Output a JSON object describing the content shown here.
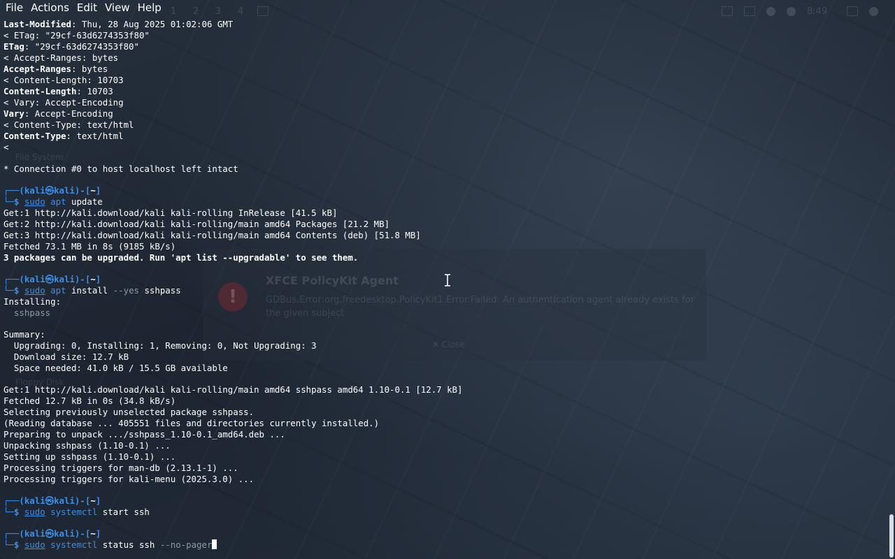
{
  "menu": [
    "File",
    "Actions",
    "Edit",
    "View",
    "Help"
  ],
  "panel": {
    "workspaces": [
      "1",
      "2",
      "3",
      "4"
    ],
    "clock": "8:49"
  },
  "ghost_dialog": {
    "title": "XFCE PolicyKit Agent",
    "message": "GDBus.Error:org.freedesktop.PolicyKit1.Error.Failed: An authentication agent already exists for the given subject",
    "button": "Close"
  },
  "ghost_desktop": {
    "icon1": "File System",
    "icon2": "Floppy Disk"
  },
  "prompt": {
    "user": "kali",
    "host": "kali",
    "dir": "~"
  },
  "terminal": {
    "header_lines": [
      {
        "key": "Last-Modified",
        "val": ": Thu, 28 Aug 2025 01:02:06 GMT",
        "bold": true
      },
      {
        "text": "< ETag: \"29cf-63d6274353f80\""
      },
      {
        "key": "ETag",
        "val": ": \"29cf-63d6274353f80\"",
        "bold": true
      },
      {
        "text": "< Accept-Ranges: bytes"
      },
      {
        "key": "Accept-Ranges",
        "val": ": bytes",
        "bold": true
      },
      {
        "text": "< Content-Length: 10703"
      },
      {
        "key": "Content-Length",
        "val": ": 10703",
        "bold": true
      },
      {
        "text": "< Vary: Accept-Encoding"
      },
      {
        "key": "Vary",
        "val": ": Accept-Encoding",
        "bold": true
      },
      {
        "text": "< Content-Type: text/html"
      },
      {
        "key": "Content-Type",
        "val": ": text/html",
        "bold": true
      },
      {
        "text": "<"
      }
    ],
    "conn_line": "* Connection #0 to host localhost left intact",
    "cmd1": {
      "sudo": "sudo",
      "prog": "apt",
      "rest": " update"
    },
    "update_output": [
      "Get:1 http://kali.download/kali kali-rolling InRelease [41.5 kB]",
      "Get:2 http://kali.download/kali kali-rolling/main amd64 Packages [21.2 MB]",
      "Get:3 http://kali.download/kali kali-rolling/main amd64 Contents (deb) [51.8 MB]",
      "Fetched 73.1 MB in 8s (9185 kB/s)"
    ],
    "upgrade_notice": "3 packages can be upgraded. Run 'apt list --upgradable' to see them.",
    "cmd2": {
      "sudo": "sudo",
      "prog": "apt",
      "mid": " install ",
      "opt": "--yes",
      "rest": " sshpass"
    },
    "installing": "Installing:",
    "pkg": "  sshpass",
    "summary_title": "Summary:",
    "summary": [
      "  Upgrading: 0, Installing: 1, Removing: 0, Not Upgrading: 3",
      "  Download size: 12.7 kB",
      "  Space needed: 41.0 kB / 15.5 GB available"
    ],
    "install_output": [
      "Get:1 http://kali.download/kali kali-rolling/main amd64 sshpass amd64 1.10-0.1 [12.7 kB]",
      "Fetched 12.7 kB in 0s (34.8 kB/s)",
      "Selecting previously unselected package sshpass.",
      "(Reading database ... 405551 files and directories currently installed.)",
      "Preparing to unpack .../sshpass_1.10-0.1_amd64.deb ...",
      "Unpacking sshpass (1.10-0.1) ...",
      "Setting up sshpass (1.10-0.1) ...",
      "Processing triggers for man-db (2.13.1-1) ...",
      "Processing triggers for kali-menu (2025.3.0) ..."
    ],
    "cmd3": {
      "sudo": "sudo",
      "prog": "systemctl",
      "rest": " start ssh"
    },
    "cmd4": {
      "sudo": "sudo",
      "prog": "systemctl",
      "mid": " status ssh ",
      "opt": "--no-pager"
    }
  }
}
